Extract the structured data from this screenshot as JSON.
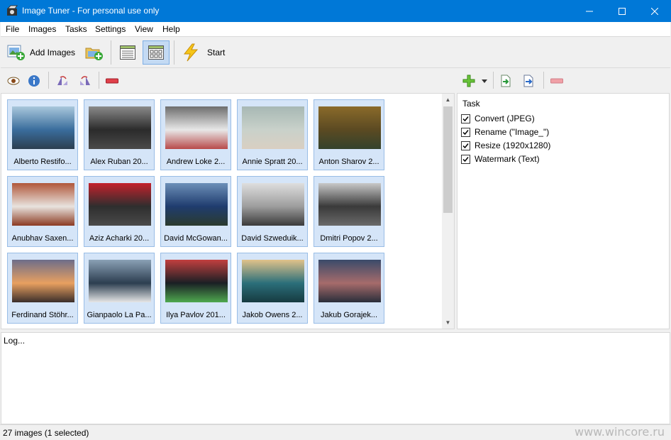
{
  "window": {
    "title": "Image Tuner - For personal use only",
    "accent_color": "#0078d7",
    "app_icon": "camera-clapper-icon",
    "controls": [
      "minimize-icon",
      "maximize-icon",
      "close-icon"
    ]
  },
  "menu": [
    "File",
    "Images",
    "Tasks",
    "Settings",
    "View",
    "Help"
  ],
  "toolbar": {
    "add_images_label": "Add Images",
    "add_images_icon": "add-image-icon",
    "add_folder_icon": "add-folder-icon",
    "list_view_icon": "list-view-icon",
    "thumbnail_view_icon": "thumbnail-view-icon",
    "start_label": "Start",
    "start_icon": "lightning-icon"
  },
  "secondary_toolbar": {
    "left": [
      "eye-icon",
      "info-icon",
      "flip-left-icon",
      "flip-right-icon",
      "remove-icon"
    ],
    "right": [
      "add-task-icon",
      "dropdown-arrow-icon",
      "import-task-icon",
      "export-task-icon",
      "remove-task-icon"
    ]
  },
  "images": [
    {
      "caption": "Alberto Restifo...",
      "c1": "#3a6d9c",
      "c2": "#a9c7dc",
      "c3": "#2c3e50"
    },
    {
      "caption": "Alex Ruban  20...",
      "c1": "#2b2b2b",
      "c2": "#8a8a8a",
      "c3": "#4a4a4a"
    },
    {
      "caption": "Andrew Loke  2...",
      "c1": "#e8e8e8",
      "c2": "#6d6d6d",
      "c3": "#b84a4a"
    },
    {
      "caption": "Annie Spratt  20...",
      "c1": "#c9d1ca",
      "c2": "#a7b8b4",
      "c3": "#d9cfc2"
    },
    {
      "caption": "Anton Sharov  2...",
      "c1": "#5b4a22",
      "c2": "#8a6a2a",
      "c3": "#34432c"
    },
    {
      "caption": "Anubhav Saxen...",
      "c1": "#e8e3de",
      "c2": "#b0573a",
      "c3": "#8b3a22"
    },
    {
      "caption": "Aziz Acharki  20...",
      "c1": "#2e2e2e",
      "c2": "#c4212c",
      "c3": "#4a4a4a"
    },
    {
      "caption": "David McGowan...",
      "c1": "#1f3c6e",
      "c2": "#6c8fb8",
      "c3": "#2b3b2e"
    },
    {
      "caption": "David Szweduik...",
      "c1": "#9d9d9d",
      "c2": "#dedede",
      "c3": "#3a3a3a"
    },
    {
      "caption": "Dmitri  Popov  2...",
      "c1": "#3a3a3a",
      "c2": "#c8c8c8",
      "c3": "#6a6a6a"
    },
    {
      "caption": "Ferdinand Stöhr...",
      "c1": "#e8a060",
      "c2": "#6d6d8a",
      "c3": "#3a2e2a"
    },
    {
      "caption": "Gianpaolo La Pa...",
      "c1": "#2c3e50",
      "c2": "#8aa0b5",
      "c3": "#e6e6e6"
    },
    {
      "caption": "Ilya Pavlov  201...",
      "c1": "#1a1f24",
      "c2": "#c23f3f",
      "c3": "#4fa84f"
    },
    {
      "caption": "Jakob Owens  2...",
      "c1": "#2b6f7a",
      "c2": "#e1c28a",
      "c3": "#163a40"
    },
    {
      "caption": "Jakub Gorajek...",
      "c1": "#a66b6b",
      "c2": "#3a4a6a",
      "c3": "#2a2e3a"
    }
  ],
  "task_panel": {
    "header": "Task",
    "tasks": [
      {
        "label": "Convert (JPEG)",
        "checked": true
      },
      {
        "label": "Rename (\"Image_\")",
        "checked": true
      },
      {
        "label": "Resize (1920x1280)",
        "checked": true
      },
      {
        "label": "Watermark (Text)",
        "checked": true
      }
    ]
  },
  "log": {
    "text": "Log..."
  },
  "status": {
    "text": "27 images (1 selected)"
  },
  "watermark": "www.wincore.ru"
}
